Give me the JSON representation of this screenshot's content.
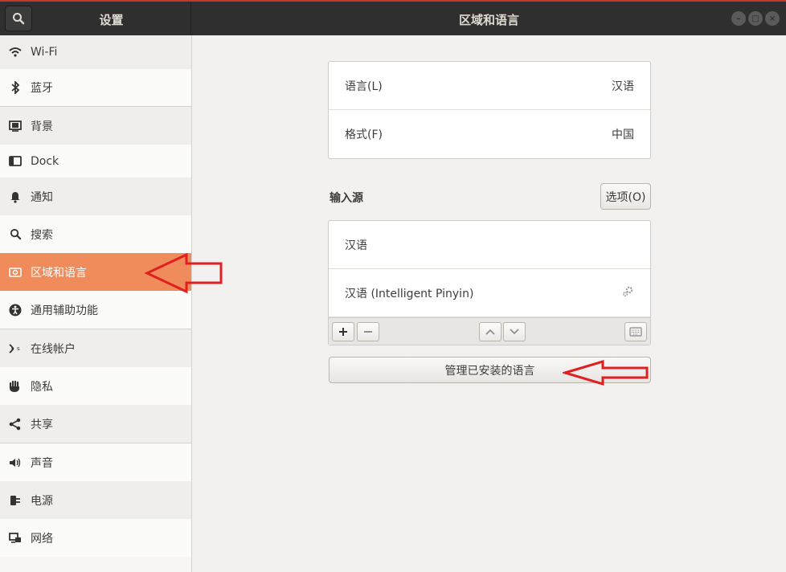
{
  "window": {
    "sidebar_title": "设置",
    "main_title": "区域和语言"
  },
  "sidebar": {
    "items": [
      {
        "label": "Wi-Fi",
        "icon": "wifi-icon"
      },
      {
        "label": "蓝牙",
        "icon": "bluetooth-icon"
      },
      {
        "label": "背景",
        "icon": "background-icon"
      },
      {
        "label": "Dock",
        "icon": "dock-icon"
      },
      {
        "label": "通知",
        "icon": "bell-icon"
      },
      {
        "label": "搜索",
        "icon": "search-icon"
      },
      {
        "label": "区域和语言",
        "icon": "region-icon",
        "active": true
      },
      {
        "label": "通用辅助功能",
        "icon": "accessibility-icon"
      },
      {
        "label": "在线帐户",
        "icon": "online-accounts-icon"
      },
      {
        "label": "隐私",
        "icon": "privacy-hand-icon"
      },
      {
        "label": "共享",
        "icon": "share-icon"
      },
      {
        "label": "声音",
        "icon": "speaker-icon"
      },
      {
        "label": "电源",
        "icon": "power-plug-icon"
      },
      {
        "label": "网络",
        "icon": "network-icon"
      }
    ]
  },
  "region": {
    "language_label": "语言(L)",
    "language_value": "汉语",
    "format_label": "格式(F)",
    "format_value": "中国"
  },
  "input_sources": {
    "section_label": "输入源",
    "options_button": "选项(O)",
    "items": [
      {
        "label": "汉语"
      },
      {
        "label": "汉语 (Intelligent Pinyin)"
      }
    ]
  },
  "manage_button": "管理已安装的语言",
  "colors": {
    "accent": "#f08c5b",
    "annotation_arrow": "#e02020"
  }
}
